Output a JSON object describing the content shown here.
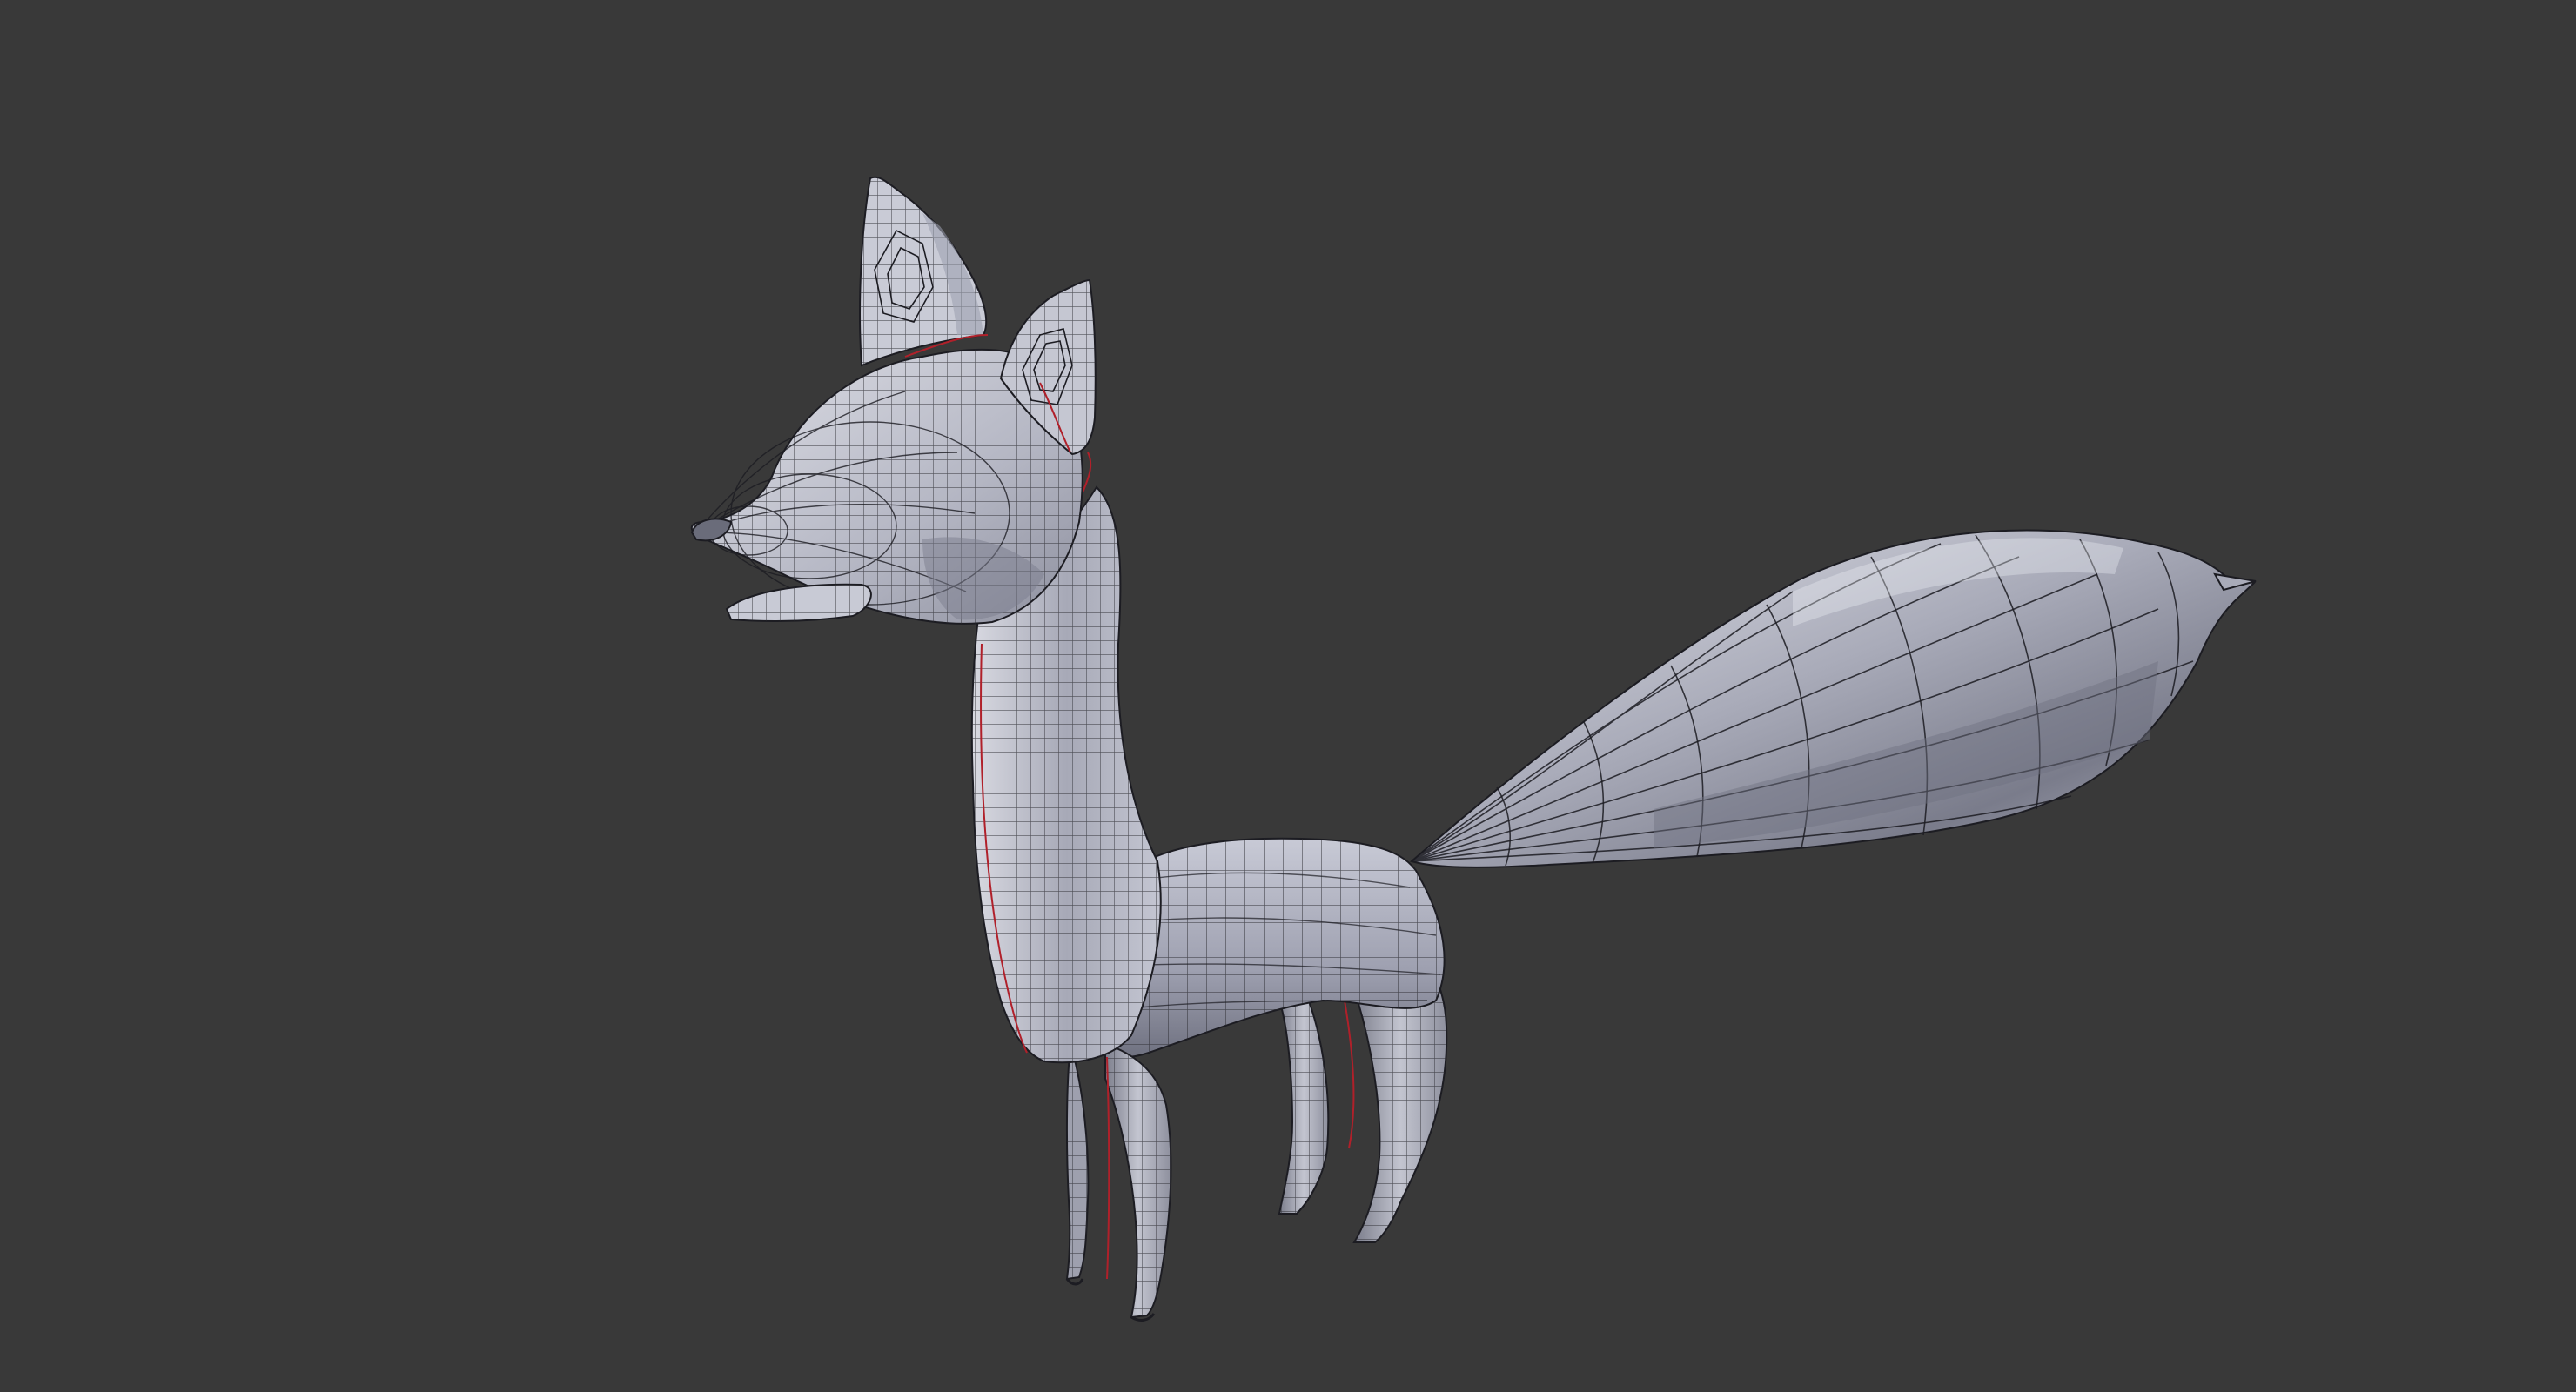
{
  "viewport": {
    "background_color": "#393939",
    "object": {
      "display": "wireframe-mesh",
      "subject": "fox",
      "surface_color": "#b8bac6",
      "surface_light_color": "#dcdde6",
      "surface_shadow_color": "#6d6f7c",
      "wire_color": "#1c1c22",
      "seam_color": "#b0202a"
    }
  }
}
